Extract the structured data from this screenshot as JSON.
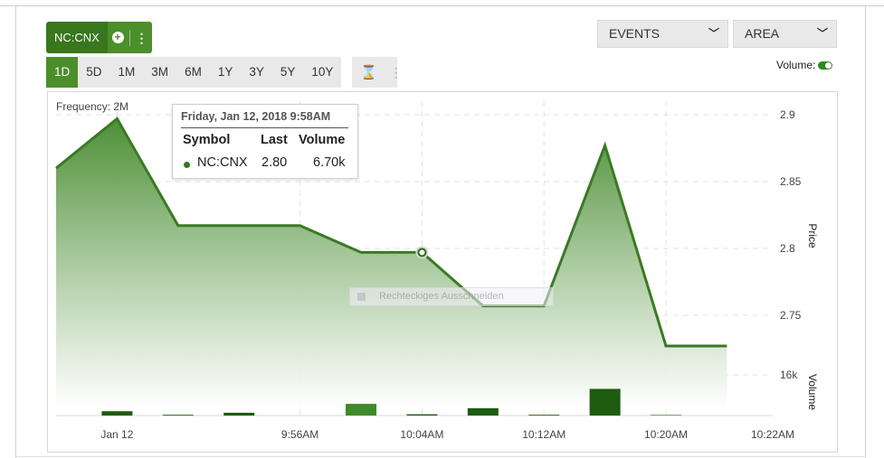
{
  "symbol": {
    "name": "NC:CNX"
  },
  "periods": [
    "1D",
    "5D",
    "1M",
    "3M",
    "6M",
    "1Y",
    "3Y",
    "5Y",
    "10Y"
  ],
  "active_period": "1D",
  "dropdowns": {
    "events": "EVENTS",
    "chart_type": "AREA"
  },
  "volume_toggle": {
    "label": "Volume:",
    "on": true
  },
  "frequency_label": "Frequency: 2M",
  "tooltip": {
    "date": "Friday, Jan 12, 2018 9:58AM",
    "headers": [
      "Symbol",
      "Last",
      "Volume"
    ],
    "row": {
      "symbol": "NC:CNX",
      "last": "2.80",
      "volume": "6.70k"
    }
  },
  "ghost_overlay": "Rechteckiges Ausschneiden",
  "colors": {
    "accent": "#4c8e2a",
    "line": "#3a7a25",
    "area_top": "#4d8f36",
    "volume_dark": "#1e5c10",
    "volume_light": "#3f8a2a"
  },
  "chart_data": {
    "type": "area",
    "xlabel": "",
    "ylabel": "Price",
    "volume_axis_label": "Volume",
    "ylim": [
      2.72,
      2.91
    ],
    "y_ticks": [
      "2.9",
      "2.85",
      "2.8",
      "2.75"
    ],
    "volume_ticks": [
      "16k"
    ],
    "x_ticks": [
      "Jan 12",
      "9:56AM",
      "10:04AM",
      "10:12AM",
      "10:20AM",
      "10:22AM"
    ],
    "x_tick_minutes": [
      -6,
      6,
      14,
      22,
      30,
      37
    ],
    "series": [
      {
        "x_minutes": [
          -10,
          -6,
          -2,
          6,
          10,
          14,
          18,
          22,
          26,
          30,
          34
        ],
        "price": [
          2.86,
          2.897,
          2.817,
          2.817,
          2.797,
          2.797,
          2.757,
          2.757,
          2.877,
          2.727,
          2.727
        ]
      }
    ],
    "volume": {
      "x_minutes": [
        -6,
        -2,
        2,
        10,
        14,
        18,
        22,
        26,
        30
      ],
      "values": [
        1.7,
        0.3,
        1.1,
        4.6,
        0.5,
        2.9,
        0.3,
        10.5,
        0.2
      ],
      "highlight_index": 3
    },
    "grid": true,
    "hover_point_index": 5
  }
}
